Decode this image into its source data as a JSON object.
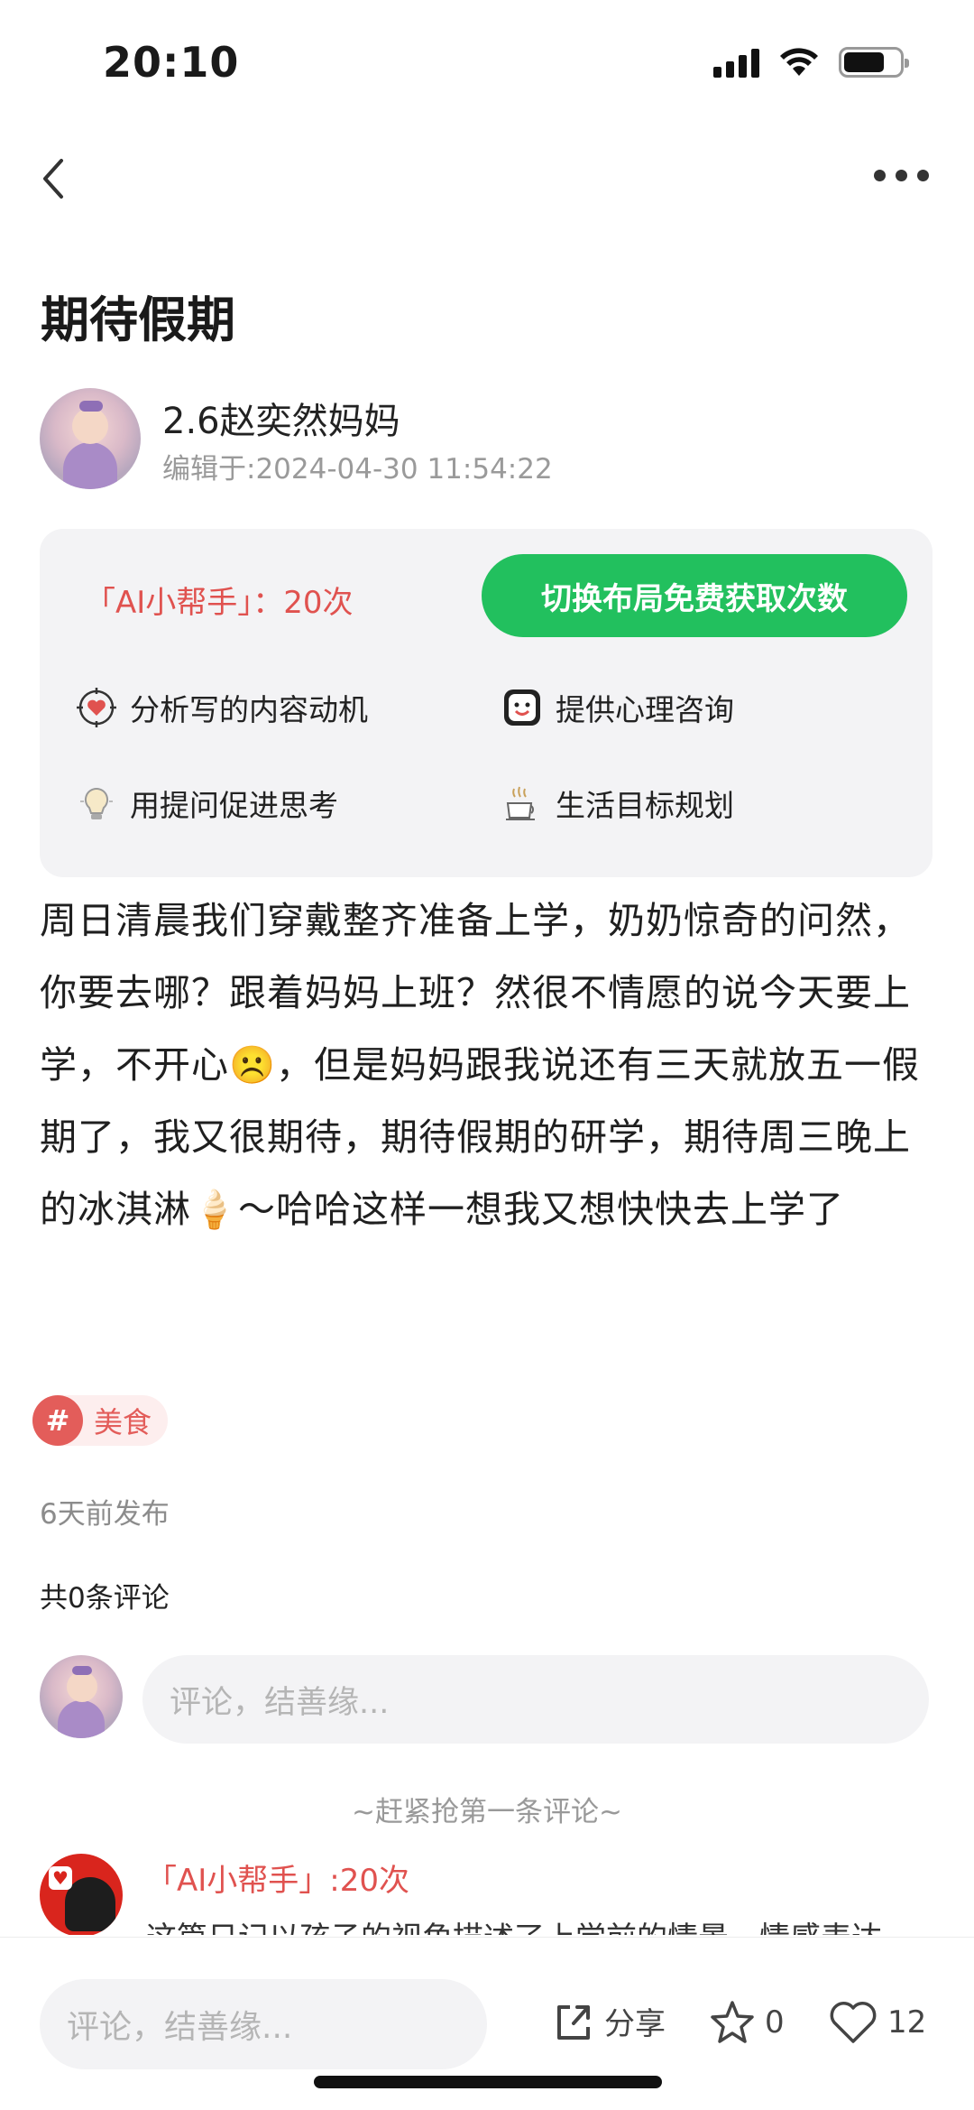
{
  "status_bar": {
    "time": "20:10"
  },
  "post": {
    "title": "期待假期",
    "author": "2.6赵奕然妈妈",
    "edited": "编辑于:2024-04-30 11:54:22",
    "content": "周日清晨我们穿戴整齐准备上学，奶奶惊奇的问然，你要去哪？跟着妈妈上班？然很不情愿的说今天要上学，不开心☹️，但是妈妈跟我说还有三天就放五一假期了，我又很期待，期待假期的研学，期待周三晚上的冰淇淋🍦～哈哈这样一想我又想快快去上学了",
    "tag": {
      "symbol": "#",
      "label": "美食"
    },
    "posted": "6天前发布",
    "comment_count": "共0条评论"
  },
  "ai_card": {
    "count_label": "「AI小帮手」：20次",
    "switch_button": "切换布局免费获取次数",
    "features": [
      {
        "label": "分析写的内容动机",
        "icon": "target-heart-icon"
      },
      {
        "label": "提供心理咨询",
        "icon": "smile-face-icon"
      },
      {
        "label": "用提问促进思考",
        "icon": "lightbulb-icon"
      },
      {
        "label": "生活目标规划",
        "icon": "coffee-cup-icon"
      }
    ]
  },
  "comment_input": {
    "placeholder": "评论，结善缘..."
  },
  "first_comment_hint": "~赶紧抢第一条评论~",
  "ai_comment": {
    "name": "「AI小帮手」:20次",
    "text": "这篇日记以孩子的视角描述了上学前的情景，情感表达"
  },
  "bottom_bar": {
    "placeholder": "评论，结善缘...",
    "share_label": "分享",
    "star_count": "0",
    "like_count": "12"
  },
  "colors": {
    "accent_green": "#22c05e",
    "accent_red": "#e0524f"
  }
}
